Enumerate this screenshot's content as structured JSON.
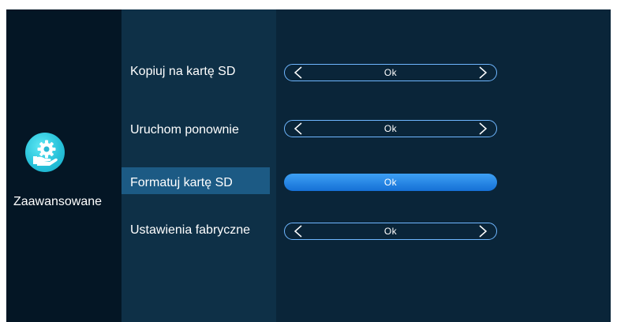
{
  "sidebar": {
    "icon": "settings-gear-hand-icon",
    "label": "Zaawansowane"
  },
  "settings": [
    {
      "label": "Kopiuj na kartę SD",
      "value": "Ok",
      "selected": false
    },
    {
      "label": "Uruchom ponownie",
      "value": "Ok",
      "selected": false
    },
    {
      "label": "Formatuj kartę SD",
      "value": "Ok",
      "selected": true
    },
    {
      "label": "Ustawienia fabryczne",
      "value": "Ok",
      "selected": false
    }
  ],
  "colors": {
    "accent": "#2a8fea",
    "icon": "#28c2da",
    "highlight": "#1c5a84"
  }
}
